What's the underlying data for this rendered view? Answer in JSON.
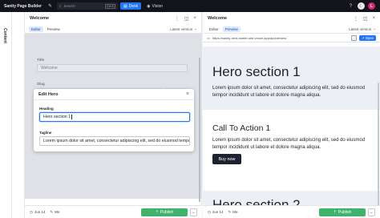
{
  "app": {
    "brand": "Sanity Page Builder",
    "search_placeholder": "Search",
    "search_shortcut": "Ctrl K",
    "tools": [
      {
        "label": "Desk"
      },
      {
        "label": "Vision"
      }
    ],
    "avatar_initial": "L"
  },
  "rail": {
    "label": "Content"
  },
  "editor_pane": {
    "title": "Welcome",
    "tabs": [
      {
        "label": "Editor"
      },
      {
        "label": "Preview"
      }
    ],
    "version": "Latest version",
    "fields": {
      "title_label": "Title",
      "title_value": "Welcome",
      "slug_label": "Slug",
      "slug_value": "/",
      "generate_label": "Generate"
    },
    "footer": {
      "date": "Jun 14",
      "edit_status": "Me",
      "publish_label": "Publish"
    }
  },
  "modal": {
    "title": "Edit Hero",
    "heading_label": "Heading",
    "heading_value": "Hero section 1",
    "tagline_label": "Tagline",
    "tagline_value": "Lorem ipsum dolor sit amet, consectetur adipiscing elit, sed do eiusmod tempor"
  },
  "preview_pane": {
    "title": "Welcome",
    "tabs": [
      {
        "label": "Editor"
      },
      {
        "label": "Preview"
      }
    ],
    "version": "Latest version",
    "url": "https://sanity-next-starter-site.vercel.app/api/preview",
    "open_label": "Open",
    "hero": {
      "heading": "Hero section 1",
      "text": "Lorem ipsum dolor sit amet, consectetur adipiscing elit, sed do eiusmod tempor incididunt ut labore et dolore magna aliqua."
    },
    "cta": {
      "heading": "Call To Action 1",
      "text": "Lorem ipsum dolor sit amet, consectetur adipiscing elit, sed do eiusmod tempor incididunt ut labore et dolore magna aliqua.",
      "button": "Buy now"
    },
    "next_heading": "Hero section 2",
    "footer": {
      "date": "Jun 14",
      "edit_status": "Me",
      "publish_label": "Publish"
    }
  },
  "colors": {
    "accent": "#2276fc",
    "publish": "#3fb26b",
    "topbar": "#13141b"
  },
  "icons": [
    "compose-icon",
    "search-icon",
    "desk-icon",
    "eye-icon",
    "help-icon",
    "moon-icon",
    "menu-dots-icon",
    "split-pane-icon",
    "close-icon",
    "chevron-down-icon",
    "clock-icon",
    "pencil-icon",
    "publish-icon",
    "monitor-icon",
    "refresh-icon",
    "open-icon"
  ]
}
